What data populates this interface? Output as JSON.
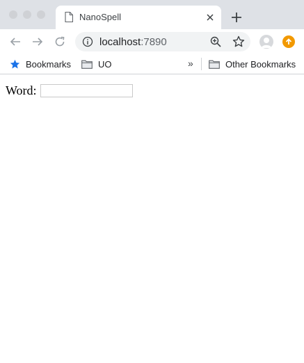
{
  "tab": {
    "title": "NanoSpell"
  },
  "omnibox": {
    "host": "localhost",
    "port": ":7890"
  },
  "bookmarks_bar": {
    "items": [
      {
        "label": "Bookmarks",
        "icon": "star-icon"
      },
      {
        "label": "UO",
        "icon": "folder-icon"
      }
    ],
    "overflow": "»",
    "other": {
      "label": "Other Bookmarks",
      "icon": "folder-icon"
    }
  },
  "form": {
    "word_label": "Word:",
    "word_value": ""
  },
  "colors": {
    "tabstrip": "#dee1e6",
    "omnibox": "#f1f3f4",
    "bookmark_star": "#1a73e8",
    "extension": "#f29900"
  }
}
